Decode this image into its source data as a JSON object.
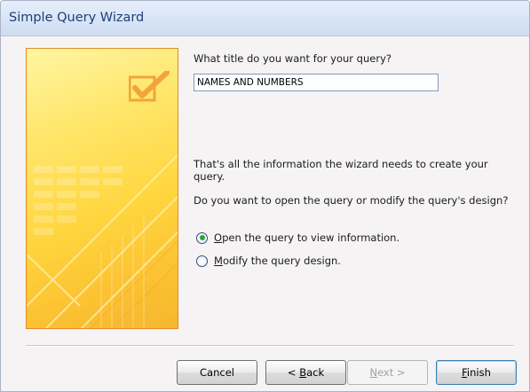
{
  "window": {
    "title": "Simple Query Wizard"
  },
  "form": {
    "title_question": "What title do you want for your query?",
    "title_value": "NAMES AND NUMBERS",
    "info": "That's all the information the wizard needs to create your query.",
    "prompt": "Do you want to open the query or modify the query's design?"
  },
  "options": [
    {
      "access_key": "O",
      "rest": "pen the query to view information.",
      "selected": true
    },
    {
      "access_key": "M",
      "rest": "odify the query design.",
      "selected": false
    }
  ],
  "buttons": {
    "cancel": {
      "label": "Cancel"
    },
    "back": {
      "prefix": "< ",
      "access_key": "B",
      "rest": "ack",
      "enabled": true
    },
    "next": {
      "access_key": "N",
      "rest": "ext >",
      "enabled": false
    },
    "finish": {
      "access_key": "F",
      "rest": "inish",
      "enabled": true
    }
  },
  "icons": {
    "banner": "wizard-checkmark-illustration",
    "checkmark": "checkmark-icon"
  },
  "colors": {
    "title_text": "#1f3d76",
    "banner_border": "#e48a2a",
    "radio_selected": "#2fa33a"
  }
}
